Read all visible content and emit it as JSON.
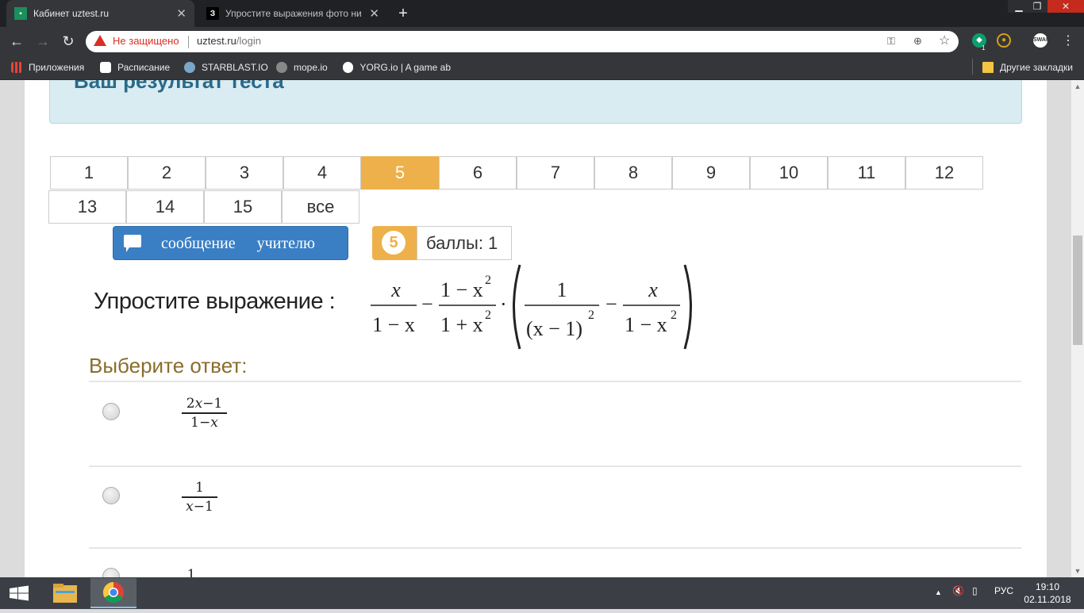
{
  "browser": {
    "tabs": [
      {
        "title": "Кабинет uztest.ru",
        "active": true,
        "favicon": "uztest-favicon"
      },
      {
        "title": "Упростите выражения фото ни",
        "active": false,
        "favicon": "znanija-favicon",
        "favicon_text": "З"
      }
    ],
    "new_tab": "+",
    "window_controls": {
      "minimize": "▁",
      "restore": "❐",
      "close": "✕"
    },
    "address": {
      "security_label": "Не защищено",
      "host": "uztest.ru",
      "path": "/login"
    },
    "bookmarks": [
      {
        "label": "Приложения",
        "icon": "apps-grid-icon"
      },
      {
        "label": "Расписание",
        "icon": "calendar-icon"
      },
      {
        "label": "STARBLAST.IO",
        "icon": "starblast-icon"
      },
      {
        "label": "mope.io",
        "icon": "mope-icon"
      },
      {
        "label": "YORG.io | A game ab",
        "icon": "yorg-icon"
      }
    ],
    "other_bookmarks": "Другие закладки",
    "extension_badge": "1",
    "swap_label": "SWAP"
  },
  "page": {
    "banner_text": "Ваш результат теста",
    "question_numbers": [
      "1",
      "2",
      "3",
      "4",
      "5",
      "6",
      "7",
      "8",
      "9",
      "10",
      "11",
      "12",
      "13",
      "14",
      "15",
      "все"
    ],
    "active_question": "5",
    "message_button": "сообщение учителю",
    "score_number": "5",
    "score_label": "баллы: 1",
    "question_label": "Упростите выражение :",
    "answer_heading": "Выберите ответ:",
    "answers": [
      {
        "num": "2𝑥−1",
        "den": "1−𝑥"
      },
      {
        "num": "1",
        "den": "𝑥−1"
      },
      {
        "num": "1",
        "den": ""
      }
    ]
  },
  "math": {
    "f1_num": "x",
    "f1_den": "1 − x",
    "minus": "−",
    "f2_num": "1 − x",
    "f2_den": "1 + x",
    "sup2": "2",
    "dot": "·",
    "f3_num": "1",
    "f3_den_base": "(x − 1)",
    "f4_num": "x",
    "f4_den": "1 − x"
  },
  "taskbar": {
    "lang": "РУС",
    "time": "19:10",
    "date": "02.11.2018"
  }
}
